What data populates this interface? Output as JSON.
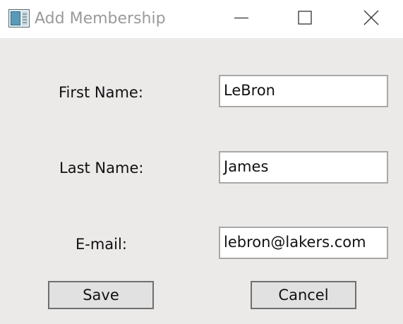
{
  "window": {
    "title": "Add Membership",
    "title_color": "#9a9a9a",
    "background": "#ece9e9"
  },
  "titlebar_icons": {
    "app": "app-window-icon",
    "minimize": "minimize-icon",
    "maximize": "maximize-icon",
    "close": "close-icon"
  },
  "form": {
    "first_name_label": "First Name:",
    "first_name_value": "LeBron",
    "last_name_label": "Last Name:",
    "last_name_value": "James",
    "email_label": "E-mail:",
    "email_value": "lebron@lakers.com"
  },
  "buttons": {
    "save": "Save",
    "cancel": "Cancel"
  }
}
